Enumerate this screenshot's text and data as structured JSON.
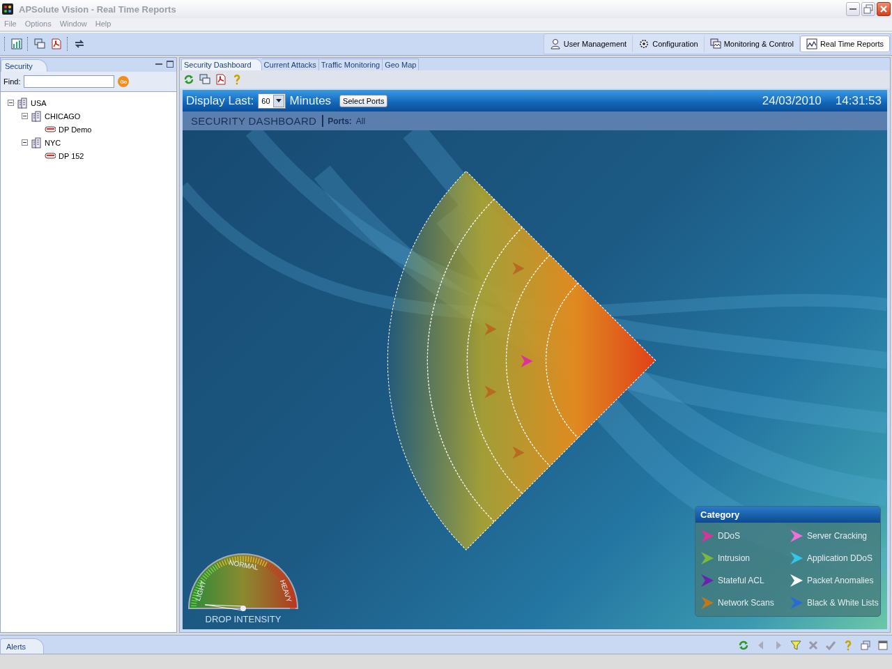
{
  "window": {
    "title": "APSolute Vision - Real Time Reports"
  },
  "menu": [
    "File",
    "Options",
    "Window",
    "Help"
  ],
  "perspectives": [
    {
      "label": "User Management",
      "selected": false
    },
    {
      "label": "Configuration",
      "selected": false
    },
    {
      "label": "Monitoring & Control",
      "selected": false
    },
    {
      "label": "Real Time Reports",
      "selected": true
    }
  ],
  "left_panel": {
    "tab": "Security",
    "find_label": "Find:",
    "go_button": "Go",
    "tree": [
      {
        "label": "USA",
        "kind": "site",
        "expanded": true,
        "children": [
          {
            "label": "CHICAGO",
            "kind": "site",
            "expanded": true,
            "children": [
              {
                "label": "DP Demo",
                "kind": "device"
              }
            ]
          },
          {
            "label": "NYC",
            "kind": "site",
            "expanded": true,
            "children": [
              {
                "label": "DP 152",
                "kind": "device"
              }
            ]
          }
        ]
      }
    ]
  },
  "tabs": [
    {
      "label": "Security Dashboard",
      "selected": true
    },
    {
      "label": "Current Attacks",
      "selected": false
    },
    {
      "label": "Traffic Monitoring",
      "selected": false
    },
    {
      "label": "Geo Map",
      "selected": false
    }
  ],
  "dashboard": {
    "display_label": "Display Last:",
    "minutes": "60",
    "minutes_label": "Minutes",
    "select_ports": "Select Ports",
    "date": "24/03/2010",
    "time": "14:31:53",
    "title": "SECURITY DASHBOARD",
    "ports_label": "Ports:",
    "ports": "All",
    "gauge": {
      "title": "DROP INTENSITY",
      "labels": [
        "LIGHT",
        "NORMAL",
        "HEAVY"
      ]
    },
    "legend": {
      "title": "Category",
      "items": [
        {
          "label": "DDoS",
          "color": "#e0309a"
        },
        {
          "label": "Server Cracking",
          "color": "#f070d8"
        },
        {
          "label": "Intrusion",
          "color": "#7ab840"
        },
        {
          "label": "Application DDoS",
          "color": "#30c8e8"
        },
        {
          "label": "Stateful ACL",
          "color": "#6a20b0"
        },
        {
          "label": "Packet Anomalies",
          "color": "#ffffff"
        },
        {
          "label": "Network Scans",
          "color": "#c07818"
        },
        {
          "label": "Black & White Lists",
          "color": "#2a6ad8"
        }
      ]
    }
  },
  "status_bar": {
    "tab": "Alerts"
  }
}
